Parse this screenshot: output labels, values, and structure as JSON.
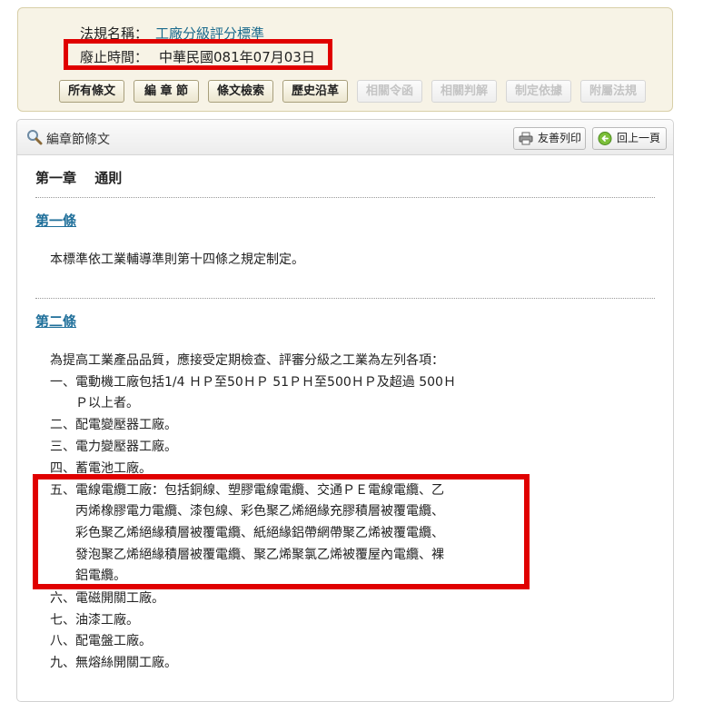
{
  "info": {
    "name_label": "法規名稱：",
    "name_value": "工廠分級評分標準",
    "abolish_label": "廢止時間：",
    "abolish_value": "中華民國081年07月03日"
  },
  "buttons": [
    {
      "label": "所有條文",
      "enabled": true
    },
    {
      "label": "編 章 節",
      "enabled": true
    },
    {
      "label": "條文檢索",
      "enabled": true
    },
    {
      "label": "歷史沿革",
      "enabled": true
    },
    {
      "label": "相關令函",
      "enabled": false
    },
    {
      "label": "相關判解",
      "enabled": false
    },
    {
      "label": "制定依據",
      "enabled": false
    },
    {
      "label": "附屬法規",
      "enabled": false
    }
  ],
  "panel": {
    "title": "編章節條文",
    "print_label": "友善列印",
    "back_label": "回上一頁"
  },
  "content": {
    "chapter": "第一章　 通則",
    "article1": {
      "title": "第一條",
      "text": "本標準依工業輔導準則第十四條之規定制定。"
    },
    "article2": {
      "title": "第二條",
      "intro": "為提高工業產品品質，應接受定期檢查、評審分級之工業為左列各項：",
      "lines": [
        "一、電動機工廠包括1/4 ＨＰ至50ＨＰ 51ＰＨ至500ＨＰ及超過 500Ｈ",
        "　　Ｐ以上者。",
        "二、配電變壓器工廠。",
        "三、電力變壓器工廠。",
        "四、蓄電池工廠。",
        "五、電線電纜工廠：包括銅線、塑膠電線電纜、交通ＰＥ電線電纜、乙",
        "　　丙烯橡膠電力電纜、漆包線、彩色聚乙烯絕緣充膠積層被覆電纜、",
        "　　彩色聚乙烯絕緣積層被覆電纜、紙絕緣鋁帶網帶聚乙烯被覆電纜、",
        "　　發泡聚乙烯絕緣積層被覆電纜、聚乙烯聚氯乙烯被覆屋內電纜、裸",
        "　　鋁電纜。",
        "六、電磁開關工廠。",
        "七、油漆工廠。",
        "八、配電盤工廠。",
        "九、無熔絲開關工廠。"
      ]
    }
  }
}
